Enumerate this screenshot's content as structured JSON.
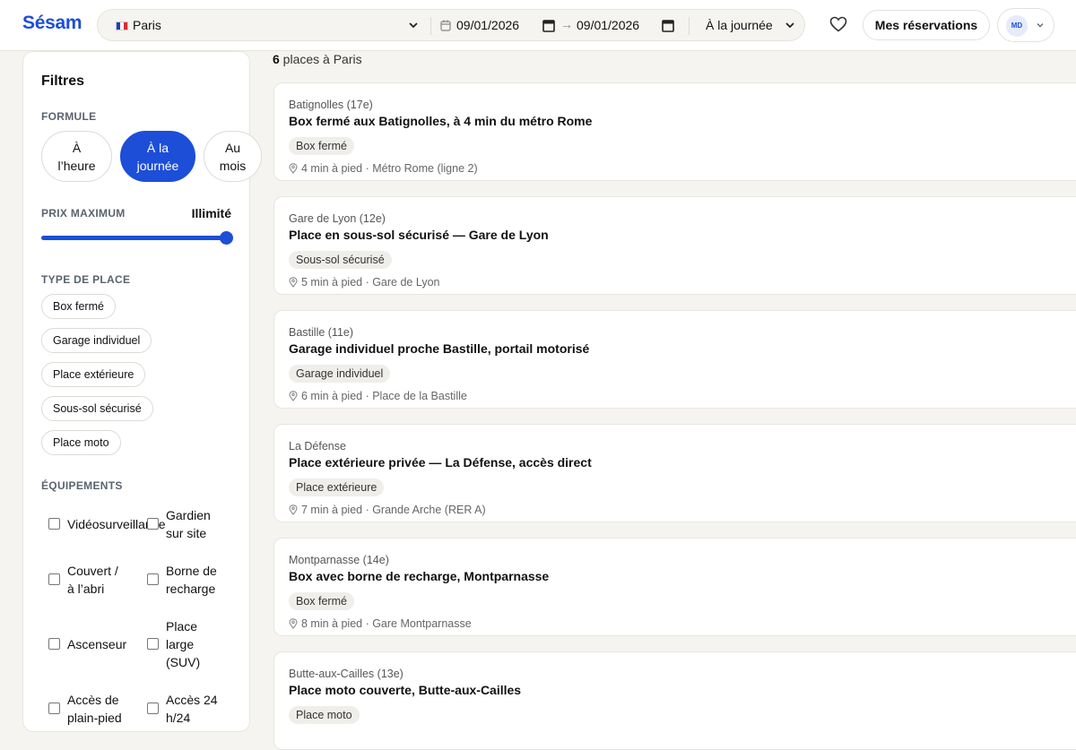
{
  "header": {
    "logo": "Sésam",
    "city": "Paris",
    "date_start": "09/01/2026",
    "date_arrow": "→",
    "date_end": "09/01/2026",
    "mode": "À la journée",
    "reservations_label": "Mes réservations",
    "avatar_initials": "MD"
  },
  "sidebar": {
    "title": "Filtres",
    "formule_label": "FORMULE",
    "formules": [
      {
        "line1": "À",
        "line2": "l’heure",
        "active": false
      },
      {
        "line1": "À la",
        "line2": "journée",
        "active": true
      },
      {
        "line1": "Au",
        "line2": "mois",
        "active": false
      }
    ],
    "price_label": "PRIX MAXIMUM",
    "price_value": "Illimité",
    "price_level_percent": 100,
    "type_label": "TYPE DE PLACE",
    "types": [
      "Box fermé",
      "Garage individuel",
      "Place extérieure",
      "Sous-sol sécurisé",
      "Place moto"
    ],
    "equip_label": "ÉQUIPEMENTS",
    "equipments": [
      [
        "Vidéosurveillance",
        "Gardien\nsur site"
      ],
      [
        "Couvert /\nà l’abri",
        "Borne de\nrecharge"
      ],
      [
        "Ascenseur",
        "Place\nlarge\n(SUV)"
      ],
      [
        "Accès de\nplain-pied",
        "Accès 24\nh/24"
      ]
    ]
  },
  "results": {
    "count": "6",
    "count_suffix": " places à Paris",
    "cards": [
      {
        "area": "Batignolles (17e)",
        "title": "Box fermé aux Batignolles, à 4 min du métro Rome",
        "tag": "Box fermé",
        "loc": "4 min à pied · Métro Rome (ligne 2)"
      },
      {
        "area": "Gare de Lyon (12e)",
        "title": "Place en sous-sol sécurisé — Gare de Lyon",
        "tag": "Sous-sol sécurisé",
        "loc": "5 min à pied · Gare de Lyon"
      },
      {
        "area": "Bastille (11e)",
        "title": "Garage individuel proche Bastille, portail motorisé",
        "tag": "Garage individuel",
        "loc": "6 min à pied · Place de la Bastille"
      },
      {
        "area": "La Défense",
        "title": "Place extérieure privée — La Défense, accès direct",
        "tag": "Place extérieure",
        "loc": "7 min à pied · Grande Arche (RER A)"
      },
      {
        "area": "Montparnasse (14e)",
        "title": "Box avec borne de recharge, Montparnasse",
        "tag": "Box fermé",
        "loc": "8 min à pied · Gare Montparnasse"
      },
      {
        "area": "Butte-aux-Cailles (13e)",
        "title": "Place moto couverte, Butte-aux-Cailles",
        "tag": "Place moto",
        "loc": ""
      }
    ]
  },
  "colors": {
    "accent": "#1d4ed8",
    "background": "#f5f4f0"
  }
}
